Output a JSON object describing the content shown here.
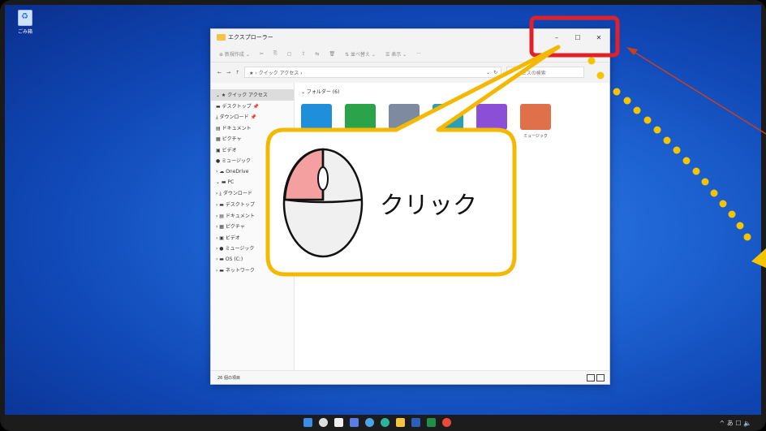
{
  "desktop": {
    "icon_label": "ごみ箱"
  },
  "window": {
    "title": "エクスプローラー",
    "controls": {
      "minimize": "–",
      "maximize": "☐",
      "close": "✕"
    },
    "commands": [
      "⊕ 新規作成 ⌄",
      "✂",
      "⎘",
      "▢",
      "⇪",
      "⇆",
      "🗑",
      "⇅ 並べ替え ⌄",
      "☰ 表示 ⌄",
      "···"
    ],
    "address": {
      "back": "←",
      "forward": "→",
      "up": "↑",
      "path": "★ › クイック アクセス ›",
      "dropdown": "⌄",
      "refresh": "↻",
      "search_placeholder": "アクセスの検索"
    },
    "nav_items": [
      {
        "label": "⌄ ★ クイック アクセス",
        "sel": true
      },
      {
        "label": "   ▬ デスクトップ  📌"
      },
      {
        "label": "   ⤓ ダウンロード  📌"
      },
      {
        "label": "   ▤ ドキュメント"
      },
      {
        "label": "   ▦ ピクチャ"
      },
      {
        "label": "   ▣ ビデオ"
      },
      {
        "label": "   ● ミュージック"
      },
      {
        "label": "› ☁ OneDrive"
      },
      {
        "label": "⌄ ▬ PC"
      },
      {
        "label": "  › ⤓ ダウンロード"
      },
      {
        "label": "  › ▬ デスクトップ"
      },
      {
        "label": "  › ▤ ドキュメント"
      },
      {
        "label": "  › ▦ ピクチャ"
      },
      {
        "label": "  › ▣ ビデオ"
      },
      {
        "label": "  › ● ミュージック"
      },
      {
        "label": "  › ▬ OS (C:)"
      },
      {
        "label": "› ▬ ネットワーク"
      }
    ],
    "group_header": "⌄ フォルダー (6)",
    "folders": [
      {
        "label": "",
        "color": "#1f8fdc"
      },
      {
        "label": "",
        "color": "#2aa34a"
      },
      {
        "label": "",
        "color": "#7d8aa0"
      },
      {
        "label": "",
        "color": "#2aa0b8"
      },
      {
        "label": "",
        "color": "#8a4fd6"
      },
      {
        "label": "ミュージック",
        "color": "#e0704a"
      }
    ],
    "status": "26 個の項目"
  },
  "callout": {
    "text": "クリック"
  },
  "taskbar": {
    "tray": "^ あ ☐ 🔈"
  }
}
